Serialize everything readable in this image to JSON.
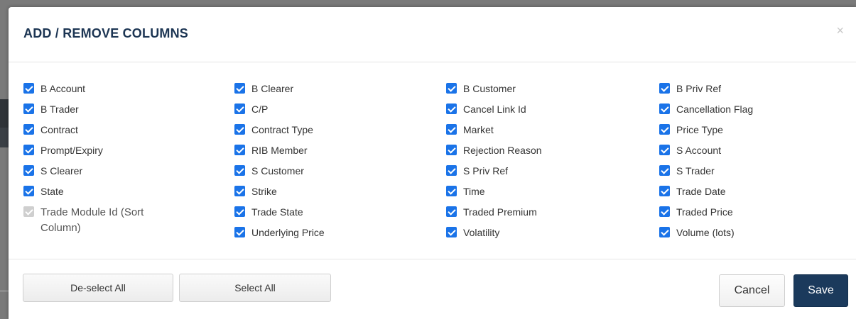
{
  "dialog": {
    "title": "ADD / REMOVE COLUMNS",
    "close_symbol": "×"
  },
  "columns": [
    [
      {
        "label": "B Account",
        "checked": true
      },
      {
        "label": "B Trader",
        "checked": true
      },
      {
        "label": "Contract",
        "checked": true
      },
      {
        "label": "Prompt/Expiry",
        "checked": true
      },
      {
        "label": "S Clearer",
        "checked": true
      },
      {
        "label": "State",
        "checked": true
      },
      {
        "label": "Trade Module Id (Sort Column)",
        "checked": true,
        "disabled": true
      }
    ],
    [
      {
        "label": "B Clearer",
        "checked": true
      },
      {
        "label": "C/P",
        "checked": true
      },
      {
        "label": "Contract Type",
        "checked": true
      },
      {
        "label": "RIB Member",
        "checked": true
      },
      {
        "label": "S Customer",
        "checked": true
      },
      {
        "label": "Strike",
        "checked": true
      },
      {
        "label": "Trade State",
        "checked": true
      },
      {
        "label": "Underlying Price",
        "checked": true
      }
    ],
    [
      {
        "label": "B Customer",
        "checked": true
      },
      {
        "label": "Cancel Link Id",
        "checked": true
      },
      {
        "label": "Market",
        "checked": true
      },
      {
        "label": "Rejection Reason",
        "checked": true
      },
      {
        "label": "S Priv Ref",
        "checked": true
      },
      {
        "label": "Time",
        "checked": true
      },
      {
        "label": "Traded Premium",
        "checked": true
      },
      {
        "label": "Volatility",
        "checked": true
      }
    ],
    [
      {
        "label": "B Priv Ref",
        "checked": true
      },
      {
        "label": "Cancellation Flag",
        "checked": true
      },
      {
        "label": "Price Type",
        "checked": true
      },
      {
        "label": "S Account",
        "checked": true
      },
      {
        "label": "S Trader",
        "checked": true
      },
      {
        "label": "Trade Date",
        "checked": true
      },
      {
        "label": "Traded Price",
        "checked": true
      },
      {
        "label": "Volume (lots)",
        "checked": true
      }
    ]
  ],
  "footer": {
    "deselect_label": "De-select All",
    "select_label": "Select All",
    "cancel_label": "Cancel",
    "save_label": "Save"
  },
  "colors": {
    "title": "#1c3553",
    "checkbox": "#1a73e8",
    "save_bg": "#1b3a5c"
  }
}
